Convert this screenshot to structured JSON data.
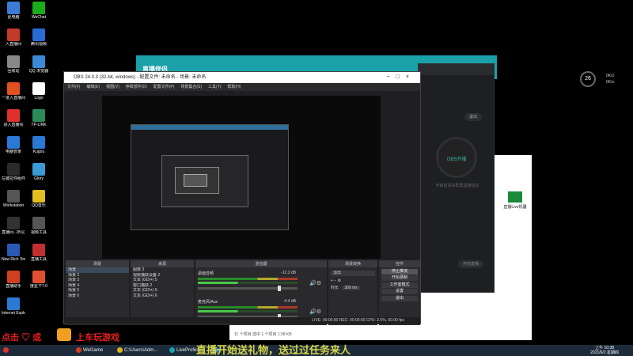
{
  "desktop_icons": [
    {
      "label": "此电脑",
      "color": "#3a7bd5"
    },
    {
      "label": "入直播间",
      "color": "#c23a2a"
    },
    {
      "label": "回收站",
      "color": "#888888"
    },
    {
      "label": "一进入直播间",
      "color": "#e05020"
    },
    {
      "label": "进入直播间",
      "color": "#e03030"
    },
    {
      "label": "电脑管家",
      "color": "#2a7ad5"
    },
    {
      "label": "左键拉你组件",
      "color": "#2a2a2a"
    },
    {
      "label": "Workstation",
      "color": "#555555"
    },
    {
      "label": "直播间...所以其升",
      "color": "#333333"
    },
    {
      "label": "New Rich Text Do...",
      "color": "#2a5ab5"
    },
    {
      "label": "直播助手",
      "color": "#d04020"
    },
    {
      "label": "Internet Explorer",
      "color": "#2a7ad5"
    },
    {
      "label": "WeChat",
      "color": "#1aad19"
    },
    {
      "label": "腾讯视频",
      "color": "#2a6ad5"
    },
    {
      "label": "QQ 浏览器",
      "color": "#3a8ad5"
    },
    {
      "label": "Logo",
      "color": "#ffffff"
    },
    {
      "label": "TP-LINK",
      "color": "#2a8a5a"
    },
    {
      "label": "Kugou",
      "color": "#2a7ad5"
    },
    {
      "label": "Glory",
      "color": "#3a9ad5"
    },
    {
      "label": "QQ音乐",
      "color": "#e0c020"
    },
    {
      "label": "视频工具",
      "color": "#555555"
    },
    {
      "label": "直播工具",
      "color": "#c03030"
    },
    {
      "label": "度星下7.0",
      "color": "#e05030"
    }
  ],
  "teal_window": {
    "title": "直播伴侣"
  },
  "obs": {
    "title": "OBS 24.0.3 (32-bit, windows) - 配置文件: 未命名 - 场景: 未命名",
    "menu": [
      "文件(F)",
      "编辑(E)",
      "视图(V)",
      "停靠部件(D)",
      "配置文件(P)",
      "场景集合(S)",
      "工具(T)",
      "帮助(H)"
    ],
    "docks": {
      "scenes": {
        "header": "场景",
        "items": [
          "场景",
          "场景 2",
          "场景 3",
          "场景 4",
          "场景 5",
          "场景 6"
        ]
      },
      "sources": {
        "header": "来源",
        "items": [
          "图像 3",
          "视频捕获设备 2",
          "文本 (GDI+) 5",
          "窗口捕获 2",
          "文本 (GDI+) 5",
          "文本 (GDI+) 6"
        ]
      },
      "mixer": {
        "header": "混音器",
        "tracks": [
          {
            "name": "桌面音频",
            "db": "-12.3 dB"
          },
          {
            "name": "麦克风/Aux",
            "db": "-4.4 dB"
          }
        ]
      },
      "transitions": {
        "header": "场景转换",
        "type": "淡出",
        "duration_label": "时长",
        "duration": "300 ms"
      },
      "controls": {
        "header": "控件",
        "buttons": [
          "停止推流",
          "开始录制",
          "工作室模式",
          "设置",
          "退出"
        ]
      }
    },
    "statusbar": "LIVE: 00:00:00   REC: 00:00:00   CPU: 2.5%, 60.00 fps"
  },
  "dark_panel": {
    "circle_label": "OBS开播",
    "quit": "退出",
    "hint": "开启前请先配置直播信息",
    "bottom_btn": "开始直播"
  },
  "white_window": {
    "status": "11 个项目   选中 1 个项目 1.58 KB",
    "thumb_label": "直播Live机器"
  },
  "sys_widget": {
    "value": "26",
    "stats": [
      "0K/s",
      "0K/s"
    ]
  },
  "promo": {
    "left": "点击 ♡ 或",
    "right": "上车玩游戏"
  },
  "scroll_text": "直播开始送礼物，送过过任务来人",
  "taskbar": {
    "items": [
      {
        "label": "",
        "color": "#e03030"
      },
      {
        "label": "WeGame",
        "color": "#d04020"
      },
      {
        "label": "C:\\Users\\Adm...",
        "color": "#e0b020"
      },
      {
        "label": "LiveProfes...",
        "color": "#1aa0a8"
      },
      {
        "label": "",
        "color": "#3a7ad5"
      }
    ],
    "time": "10:38",
    "date": "2021/6/2 星期四",
    "ampm": "上午"
  }
}
